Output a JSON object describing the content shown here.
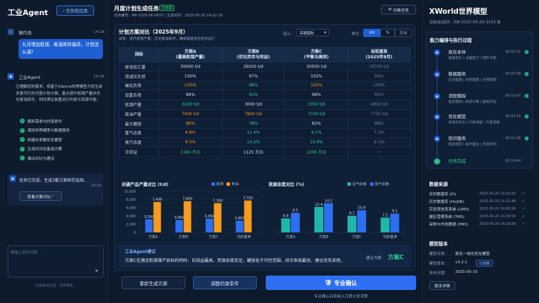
{
  "left": {
    "app_title": "工业Agent",
    "back_button": "任务和应用",
    "user_name": "操作员",
    "user_time": "14:28",
    "user_message": "九月增加航煤、柴油库存偏高，计划怎么调?",
    "agent_name": "工业Agent",
    "agent_time": "14:28",
    "agent_intro": "已理解您的需求，将基于XWorld世界模型为您生成多套可行的月度计划方案，重点提升航煤产量并优化柴油库存，同时满足装置运行约束与资源平衡。",
    "steps": [
      "解析需求与约束条件",
      "调用世界模型与数据服务",
      "构建并求解优化模型",
      "生成并评估备选方案",
      "输出对比与建议"
    ],
    "done_text": "任务已完成，生成3套方案供您选择。",
    "done_time": "14:32",
    "view_button": "查看方案对比",
    "input_placeholder": "请输入您的问题...",
    "footer": "内容由AI生成，仅供参考"
  },
  "header": {
    "task_title": "月度计划生成任务",
    "badge": "已完成",
    "task_meta": "任务编号：MP-2025-06-0007  |  生成时间：2025-05-20 14:32:18",
    "switch_button": "切换任务"
  },
  "card": {
    "title": "计划方案对比（2025年9月）",
    "subtitle": "目标：提升航煤产量，优化柴油库存，确保装置安全经济运行",
    "display_label": "显示：",
    "display_value": "关键指标",
    "unit_label": "单位：",
    "units": [
      "t/d",
      "%",
      "万元"
    ],
    "columns": [
      [
        "指标",
        ""
      ],
      [
        "方案A",
        "(最高航煤产量)"
      ],
      [
        "方案B",
        "(优化库存与效益)"
      ],
      [
        "方案C",
        "(平衡与高效)"
      ],
      [
        "当前基准",
        "(2025年8月)"
      ]
    ],
    "rows": [
      {
        "label": "原油加工量",
        "a": "30000 t/d",
        "b": "29200 t/d",
        "c": "30500 t/d",
        "base": "29700 t/d"
      },
      {
        "label": "常减压负荷",
        "a": "100%",
        "b": "97%",
        "c": "102%",
        "base": "99%"
      },
      {
        "label": "催化负荷",
        "a": "105%",
        "b": "98%",
        "c": "102%",
        "base": "100%"
      },
      {
        "label": "加氢负荷",
        "a": "96%",
        "b": "91%",
        "c": "98%",
        "base": "95%"
      },
      {
        "label": "航煤产量",
        "a": "3200 t/d",
        "b": "3000 t/d",
        "c": "3350 t/d",
        "base": "2850 t/d"
      },
      {
        "label": "柴油产量",
        "a": "7400 t/d",
        "b": "7600 t/d",
        "c": "7100 t/d",
        "base": "7750 t/d"
      },
      {
        "label": "最大罐容",
        "a": "86%",
        "b": "78%",
        "c": "82%",
        "base": "88%"
      },
      {
        "label": "氢气余度",
        "a": "6.8%",
        "b": "12.4%",
        "c": "8.1%",
        "base": "7.2%"
      },
      {
        "label": "蒸汽余度",
        "a": "9.5%",
        "b": "14.2%",
        "c": "10.8%",
        "base": "9.1%"
      },
      {
        "label": "日效益",
        "a": "1160 万元",
        "b": "1125 万元",
        "c": "1206 万元",
        "base": "—"
      }
    ],
    "colors": {
      "orange": "#f79a1e",
      "green": "#2fcf8d",
      "teal": "#27c2b6",
      "blue": "#2d6ff0"
    }
  },
  "chart_data": [
    {
      "type": "bar",
      "title": "关键产品产量对比 (t/d)",
      "categories": [
        "方案A",
        "方案B",
        "方案C",
        "当前基准"
      ],
      "series": [
        {
          "name": "航煤",
          "values": [
            3200,
            3000,
            3350,
            2850
          ],
          "color": "#2d6ff0"
        },
        {
          "name": "柴油",
          "values": [
            7400,
            7600,
            7100,
            7750
          ],
          "color": "#f79a1e"
        }
      ],
      "ylim": [
        0,
        10000
      ],
      "yticks": [
        "10,000",
        "8,000",
        "6,000",
        "4,000",
        "2,000",
        "0"
      ]
    },
    {
      "type": "bar",
      "title": "资源余度对比 (%)",
      "categories": [
        "方案A",
        "方案B",
        "方案C",
        "当前基准"
      ],
      "series": [
        {
          "name": "氢气余度",
          "values": [
            6.8,
            12.4,
            8.1,
            7.2
          ],
          "color": "#1fb7a8"
        },
        {
          "name": "蒸汽余度",
          "values": [
            9.5,
            14.2,
            10.8,
            9.1
          ],
          "color": "#2d6ff0"
        }
      ],
      "ylim": [
        0,
        20
      ]
    }
  ],
  "suggestion": {
    "title": "工业Agent建议",
    "text": "方案C在满足航煤增产目标的同时，日效益最高，资源余度充足，罐容处于可控范围，综合表现最优，建议优先采用。",
    "label": "建议方案：",
    "value": "方案C"
  },
  "actions": {
    "regen": "重新生成方案",
    "adjust": "调整约束条件",
    "confirm": "专业确认",
    "note": "专业确认后将纳入月度计划流程"
  },
  "right": {
    "title": "XWorld世界模型",
    "info_icon": "ⓘ",
    "version_line": "当前会话ID：XW-2025-05-20-1432",
    "process_title": "能力编排与执行过程",
    "nodes": [
      {
        "title": "炼化本体",
        "sub": "装置拓扑 | 设备能力 | 物料平衡",
        "time": "00:03:31"
      },
      {
        "title": "数据服务",
        "sub": "历史数据 | 实时数据 | 外部数据",
        "time": "00:07:58"
      },
      {
        "title": "流程模拟",
        "sub": "稳态模拟 | 收率计算 | 能耗评估",
        "time": "00:03:47"
      },
      {
        "title": "优化模型",
        "sub": "多目标优化 | 约束求解 | 方案求解",
        "time": "00:04:15"
      },
      {
        "title": "知识服务",
        "sub": "经验规则 | 操作建议 | 异常检测",
        "time": "00:01:36"
      },
      {
        "title": "任务完成",
        "sub": "",
        "time": "00:14:04"
      }
    ],
    "ds_title": "数据来源",
    "sources": [
      {
        "name": "实时数据库 (PI)",
        "time": "2025-05-20 14:31:00"
      },
      {
        "name": "历史数据库 (HisDB)",
        "time": "2025-05-20 14:31:48"
      },
      {
        "name": "实验室信息系统 (LIMS)",
        "time": "2025-05-20 14:30:56"
      },
      {
        "name": "罐区管理系统 (TMS)",
        "time": "2025-05-20 14:30:06"
      },
      {
        "name": "采购与市场数据 (PMS)",
        "time": "2025-05-20 14:29:58"
      }
    ],
    "mv_title": "模型版本",
    "mv_name_label": "模型名称：",
    "mv_name": "炼化一体化优化模型",
    "mv_ver_label": "模型版本：",
    "mv_ver": "v3.2.1",
    "mv_status": "已部署",
    "mv_date_label": "发布日期：",
    "mv_date": "2025-05-15",
    "mv_button": "版本详情"
  }
}
